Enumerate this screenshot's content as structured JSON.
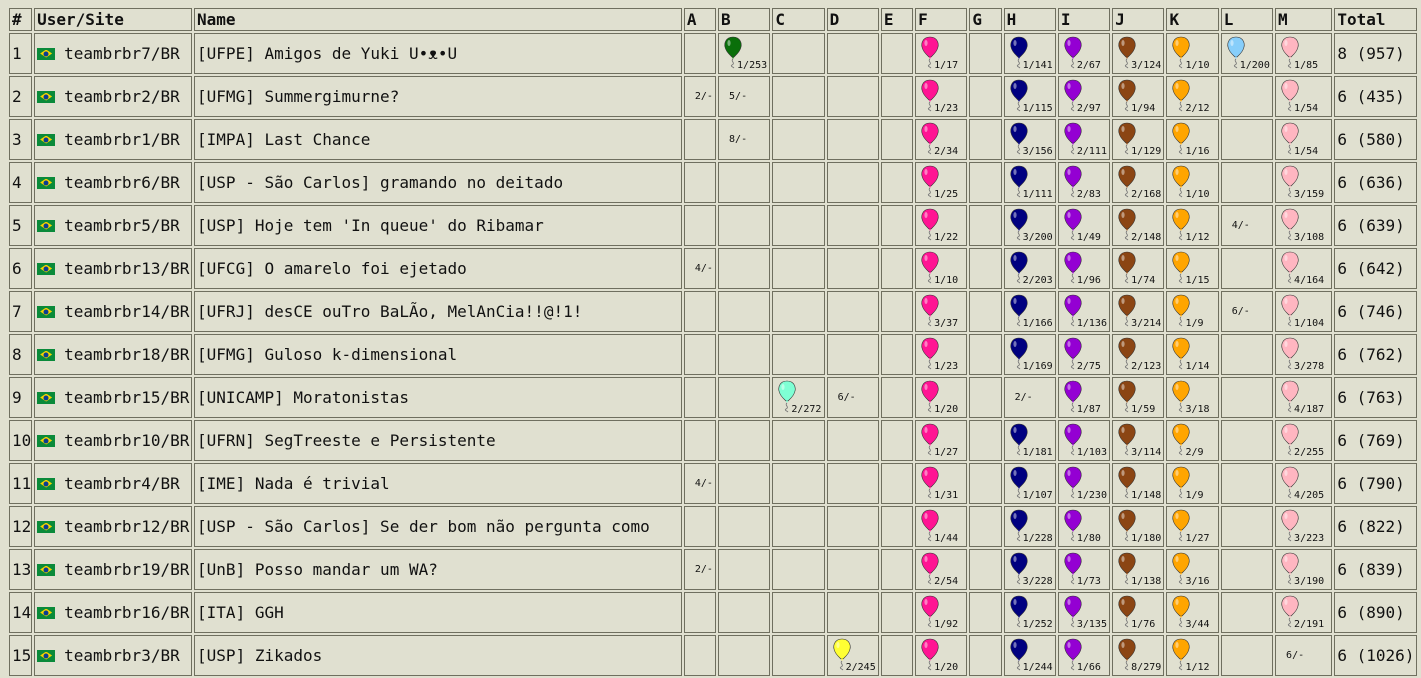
{
  "headers": {
    "rank": "#",
    "user": "User/Site",
    "name": "Name",
    "problems": [
      "A",
      "B",
      "C",
      "D",
      "E",
      "F",
      "G",
      "H",
      "I",
      "J",
      "K",
      "L",
      "M"
    ],
    "total": "Total"
  },
  "problem_colors": {
    "B": "#0a6f0a",
    "C": "#7fffd4",
    "D": "#ffff33",
    "F": "#ff1493",
    "H": "#000080",
    "I": "#9400d3",
    "J": "#8b4513",
    "K": "#ffa500",
    "L": "#87cefa",
    "M": "#ffb6c1"
  },
  "rows": [
    {
      "rank": "1",
      "user": "teambrbr7/BR",
      "name": "[UFPE] Amigos de Yuki U•ᴥ•U",
      "total": "8 (957)",
      "cells": [
        null,
        {
          "s": "1/253",
          "b": true
        },
        null,
        null,
        null,
        {
          "s": "1/17",
          "b": true
        },
        null,
        {
          "s": "1/141",
          "b": true
        },
        {
          "s": "2/67",
          "b": true
        },
        {
          "s": "3/124",
          "b": true
        },
        {
          "s": "1/10",
          "b": true
        },
        {
          "s": "1/200",
          "b": true
        },
        {
          "s": "1/85",
          "b": true
        }
      ]
    },
    {
      "rank": "2",
      "user": "teambrbr2/BR",
      "name": "[UFMG] Summergimurne?",
      "total": "6 (435)",
      "cells": [
        {
          "s": "2/-",
          "b": false
        },
        {
          "s": "5/-",
          "b": false
        },
        null,
        null,
        null,
        {
          "s": "1/23",
          "b": true
        },
        null,
        {
          "s": "1/115",
          "b": true
        },
        {
          "s": "2/97",
          "b": true
        },
        {
          "s": "1/94",
          "b": true
        },
        {
          "s": "2/12",
          "b": true
        },
        null,
        {
          "s": "1/54",
          "b": true
        }
      ]
    },
    {
      "rank": "3",
      "user": "teambrbr1/BR",
      "name": "[IMPA] Last Chance",
      "total": "6 (580)",
      "cells": [
        null,
        {
          "s": "8/-",
          "b": false
        },
        null,
        null,
        null,
        {
          "s": "2/34",
          "b": true
        },
        null,
        {
          "s": "3/156",
          "b": true
        },
        {
          "s": "2/111",
          "b": true
        },
        {
          "s": "1/129",
          "b": true
        },
        {
          "s": "1/16",
          "b": true
        },
        null,
        {
          "s": "1/54",
          "b": true
        }
      ]
    },
    {
      "rank": "4",
      "user": "teambrbr6/BR",
      "name": "[USP - São Carlos] gramando no deitado",
      "total": "6 (636)",
      "cells": [
        null,
        null,
        null,
        null,
        null,
        {
          "s": "1/25",
          "b": true
        },
        null,
        {
          "s": "1/111",
          "b": true
        },
        {
          "s": "2/83",
          "b": true
        },
        {
          "s": "2/168",
          "b": true
        },
        {
          "s": "1/10",
          "b": true
        },
        null,
        {
          "s": "3/159",
          "b": true
        }
      ]
    },
    {
      "rank": "5",
      "user": "teambrbr5/BR",
      "name": "[USP] Hoje tem 'In queue' do Ribamar",
      "total": "6 (639)",
      "cells": [
        null,
        null,
        null,
        null,
        null,
        {
          "s": "1/22",
          "b": true
        },
        null,
        {
          "s": "3/200",
          "b": true
        },
        {
          "s": "1/49",
          "b": true
        },
        {
          "s": "2/148",
          "b": true
        },
        {
          "s": "1/12",
          "b": true
        },
        {
          "s": "4/-",
          "b": false
        },
        {
          "s": "3/108",
          "b": true
        }
      ]
    },
    {
      "rank": "6",
      "user": "teambrbr13/BR",
      "name": "[UFCG] O amarelo foi ejetado",
      "total": "6 (642)",
      "cells": [
        {
          "s": "4/-",
          "b": false
        },
        null,
        null,
        null,
        null,
        {
          "s": "1/10",
          "b": true
        },
        null,
        {
          "s": "2/203",
          "b": true
        },
        {
          "s": "1/96",
          "b": true
        },
        {
          "s": "1/74",
          "b": true
        },
        {
          "s": "1/15",
          "b": true
        },
        null,
        {
          "s": "4/164",
          "b": true
        }
      ]
    },
    {
      "rank": "7",
      "user": "teambrbr14/BR",
      "name": "[UFRJ] desCE ouTro BaLÃo, MelAnCia!!@!1!",
      "total": "6 (746)",
      "cells": [
        null,
        null,
        null,
        null,
        null,
        {
          "s": "3/37",
          "b": true
        },
        null,
        {
          "s": "1/166",
          "b": true
        },
        {
          "s": "1/136",
          "b": true
        },
        {
          "s": "3/214",
          "b": true
        },
        {
          "s": "1/9",
          "b": true
        },
        {
          "s": "6/-",
          "b": false
        },
        {
          "s": "1/104",
          "b": true
        }
      ]
    },
    {
      "rank": "8",
      "user": "teambrbr18/BR",
      "name": "[UFMG] Guloso k-dimensional",
      "total": "6 (762)",
      "cells": [
        null,
        null,
        null,
        null,
        null,
        {
          "s": "1/23",
          "b": true
        },
        null,
        {
          "s": "1/169",
          "b": true
        },
        {
          "s": "2/75",
          "b": true
        },
        {
          "s": "2/123",
          "b": true
        },
        {
          "s": "1/14",
          "b": true
        },
        null,
        {
          "s": "3/278",
          "b": true
        }
      ]
    },
    {
      "rank": "9",
      "user": "teambrbr15/BR",
      "name": "[UNICAMP] Moratonistas",
      "total": "6 (763)",
      "cells": [
        null,
        null,
        {
          "s": "2/272",
          "b": true
        },
        {
          "s": "6/-",
          "b": false
        },
        null,
        {
          "s": "1/20",
          "b": true
        },
        null,
        {
          "s": "2/-",
          "b": false
        },
        {
          "s": "1/87",
          "b": true
        },
        {
          "s": "1/59",
          "b": true
        },
        {
          "s": "3/18",
          "b": true
        },
        null,
        {
          "s": "4/187",
          "b": true
        }
      ]
    },
    {
      "rank": "10",
      "user": "teambrbr10/BR",
      "name": "[UFRN] SegTreeste e Persistente",
      "total": "6 (769)",
      "cells": [
        null,
        null,
        null,
        null,
        null,
        {
          "s": "1/27",
          "b": true
        },
        null,
        {
          "s": "1/181",
          "b": true
        },
        {
          "s": "1/103",
          "b": true
        },
        {
          "s": "3/114",
          "b": true
        },
        {
          "s": "2/9",
          "b": true
        },
        null,
        {
          "s": "2/255",
          "b": true
        }
      ]
    },
    {
      "rank": "11",
      "user": "teambrbr4/BR",
      "name": "[IME] Nada é trivial",
      "total": "6 (790)",
      "cells": [
        {
          "s": "4/-",
          "b": false
        },
        null,
        null,
        null,
        null,
        {
          "s": "1/31",
          "b": true
        },
        null,
        {
          "s": "1/107",
          "b": true
        },
        {
          "s": "1/230",
          "b": true
        },
        {
          "s": "1/148",
          "b": true
        },
        {
          "s": "1/9",
          "b": true
        },
        null,
        {
          "s": "4/205",
          "b": true
        }
      ]
    },
    {
      "rank": "12",
      "user": "teambrbr12/BR",
      "name": "[USP - São Carlos] Se der bom não pergunta como",
      "total": "6 (822)",
      "cells": [
        null,
        null,
        null,
        null,
        null,
        {
          "s": "1/44",
          "b": true
        },
        null,
        {
          "s": "1/228",
          "b": true
        },
        {
          "s": "1/80",
          "b": true
        },
        {
          "s": "1/180",
          "b": true
        },
        {
          "s": "1/27",
          "b": true
        },
        null,
        {
          "s": "3/223",
          "b": true
        }
      ]
    },
    {
      "rank": "13",
      "user": "teambrbr19/BR",
      "name": "[UnB] Posso mandar um WA?",
      "total": "6 (839)",
      "cells": [
        {
          "s": "2/-",
          "b": false
        },
        null,
        null,
        null,
        null,
        {
          "s": "2/54",
          "b": true
        },
        null,
        {
          "s": "3/228",
          "b": true
        },
        {
          "s": "1/73",
          "b": true
        },
        {
          "s": "1/138",
          "b": true
        },
        {
          "s": "3/16",
          "b": true
        },
        null,
        {
          "s": "3/190",
          "b": true
        }
      ]
    },
    {
      "rank": "14",
      "user": "teambrbr16/BR",
      "name": "[ITA] GGH",
      "total": "6 (890)",
      "cells": [
        null,
        null,
        null,
        null,
        null,
        {
          "s": "1/92",
          "b": true
        },
        null,
        {
          "s": "1/252",
          "b": true
        },
        {
          "s": "3/135",
          "b": true
        },
        {
          "s": "1/76",
          "b": true
        },
        {
          "s": "3/44",
          "b": true
        },
        null,
        {
          "s": "2/191",
          "b": true
        }
      ]
    },
    {
      "rank": "15",
      "user": "teambrbr3/BR",
      "name": "[USP] Zikados",
      "total": "6 (1026)",
      "cells": [
        null,
        null,
        null,
        {
          "s": "2/245",
          "b": true
        },
        null,
        {
          "s": "1/20",
          "b": true
        },
        null,
        {
          "s": "1/244",
          "b": true
        },
        {
          "s": "1/66",
          "b": true
        },
        {
          "s": "8/279",
          "b": true
        },
        {
          "s": "1/12",
          "b": true
        },
        null,
        {
          "s": "6/-",
          "b": false
        }
      ]
    }
  ]
}
